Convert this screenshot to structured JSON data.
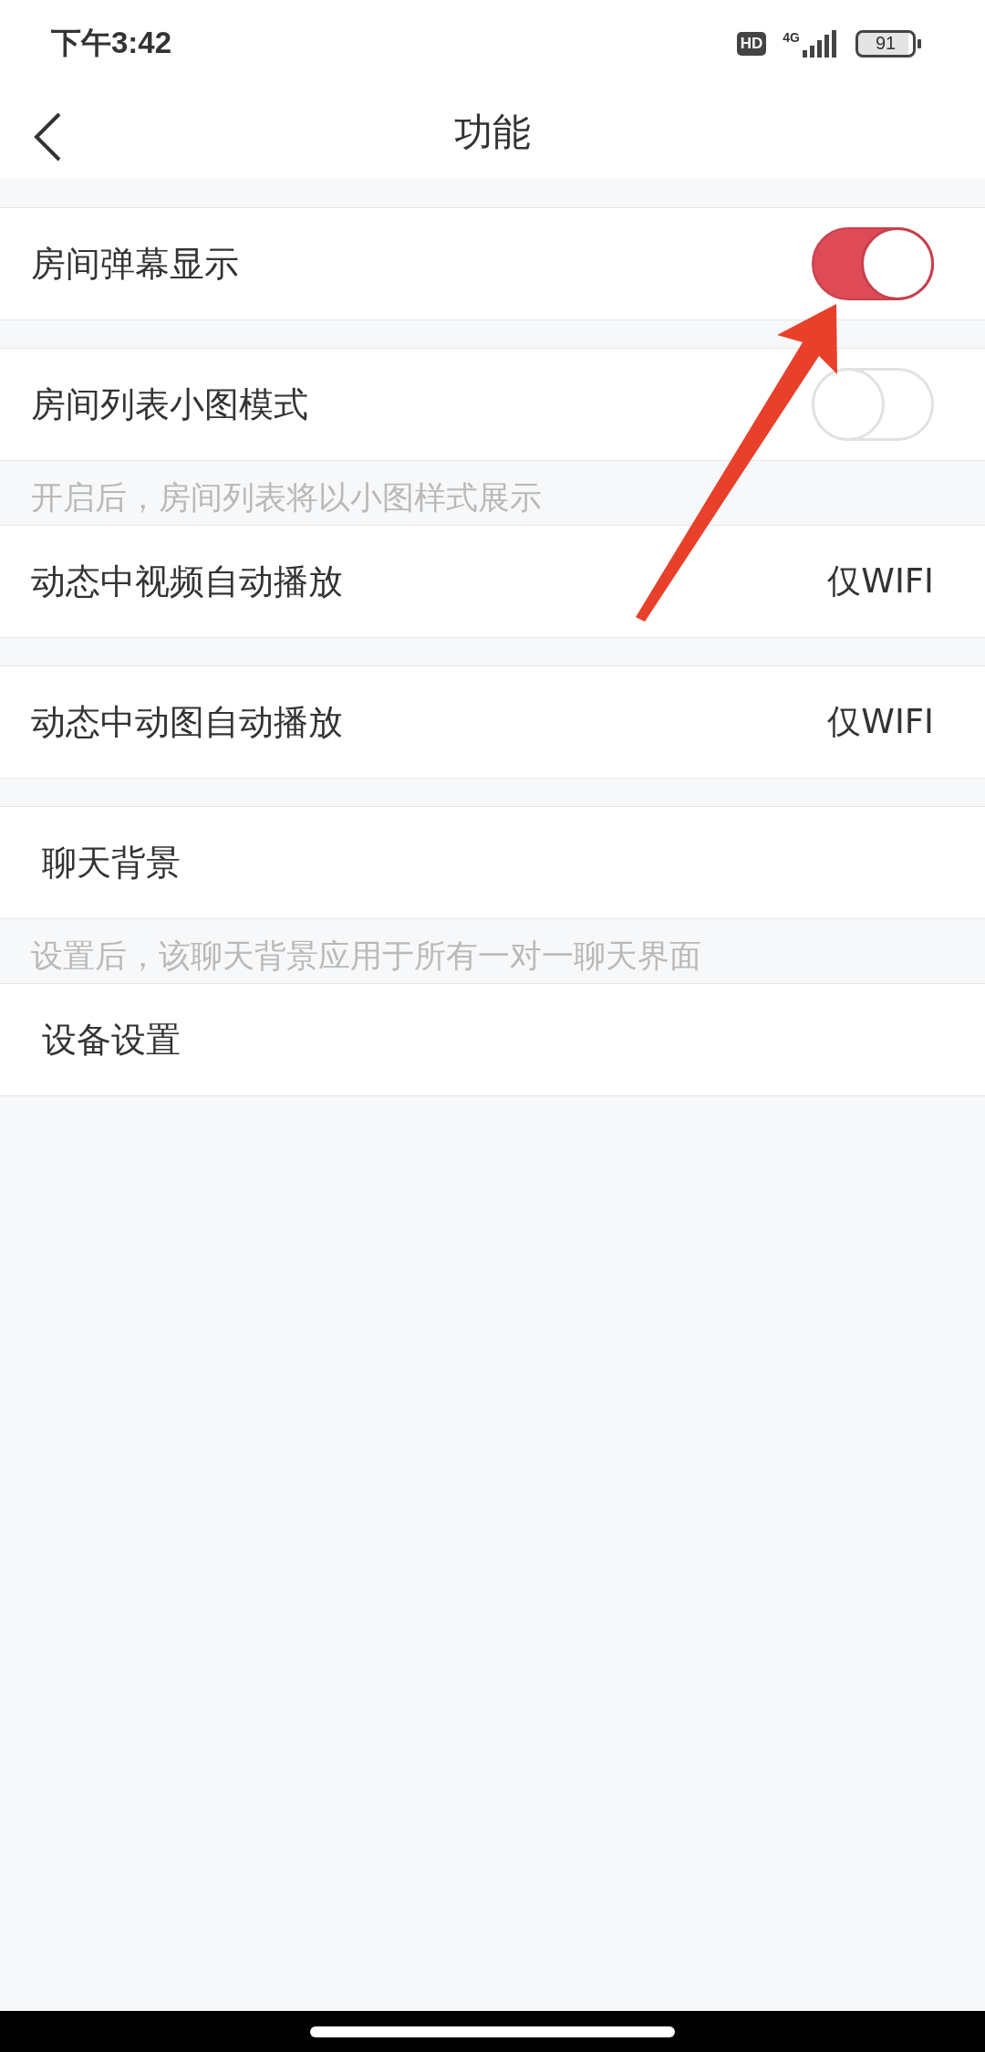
{
  "status_bar": {
    "time": "下午3:42",
    "hd_badge": "HD",
    "network": "4G",
    "battery": "91"
  },
  "nav": {
    "title": "功能"
  },
  "sections": [
    {
      "rows": [
        {
          "kind": "toggle",
          "label": "房间弹幕显示",
          "on": true
        }
      ]
    },
    {
      "rows": [
        {
          "kind": "toggle",
          "label": "房间列表小图模式",
          "on": false
        }
      ],
      "hint": "开启后，房间列表将以小图样式展示"
    },
    {
      "rows": [
        {
          "kind": "value",
          "label": "动态中视频自动播放",
          "value": "仅WIFI"
        }
      ]
    },
    {
      "rows": [
        {
          "kind": "value",
          "label": "动态中动图自动播放",
          "value": "仅WIFI"
        }
      ]
    },
    {
      "rows": [
        {
          "kind": "plain",
          "label": "聊天背景"
        }
      ],
      "hint": "设置后，该聊天背景应用于所有一对一聊天界面"
    },
    {
      "rows": [
        {
          "kind": "plain",
          "label": "设备设置"
        }
      ]
    }
  ]
}
